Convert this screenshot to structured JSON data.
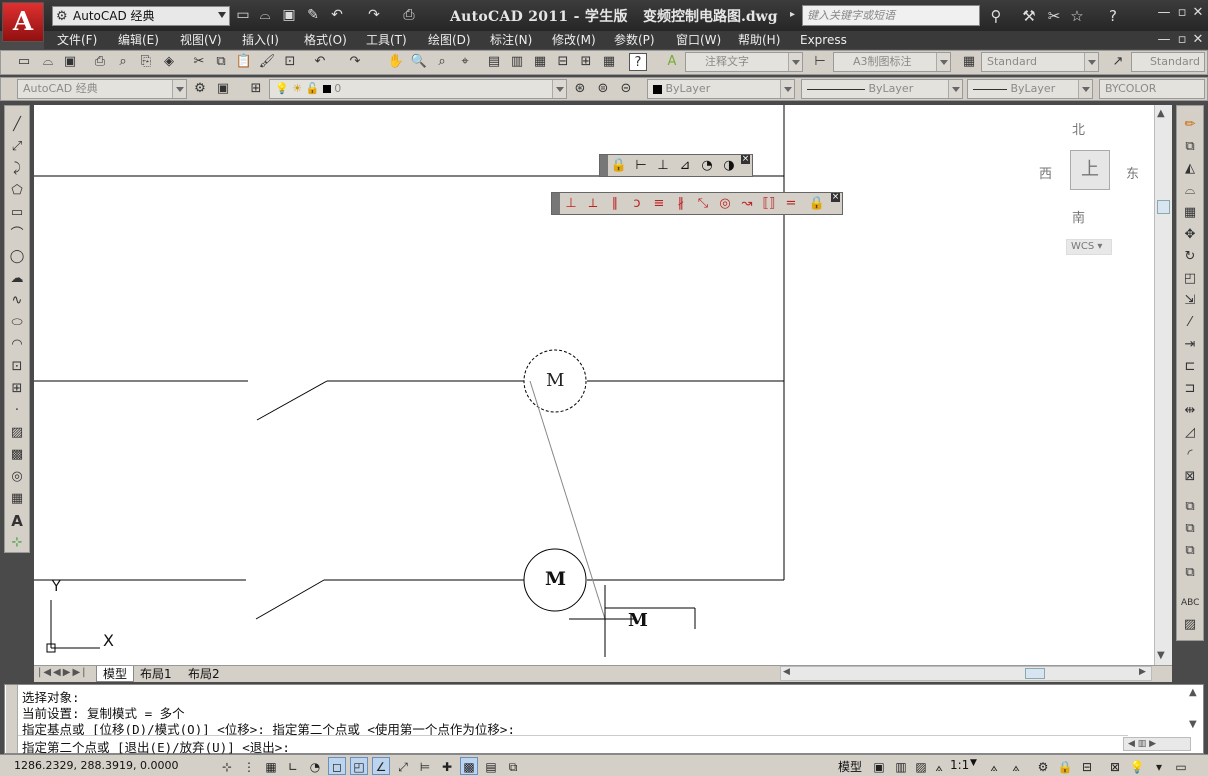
{
  "title": {
    "app": "AutoCAD 2011 - 学生版",
    "file": "变频控制电路图.dwg",
    "workspace": "AutoCAD 经典",
    "search_placeholder": "键入关键字或短语"
  },
  "menus": [
    "文件(F)",
    "编辑(E)",
    "视图(V)",
    "插入(I)",
    "格式(O)",
    "工具(T)",
    "绘图(D)",
    "标注(N)",
    "修改(M)",
    "参数(P)",
    "窗口(W)",
    "帮助(H)",
    "Express"
  ],
  "toolbar": {
    "text_style": "注释文字",
    "dim_style": "A3制图标注",
    "table_style": "Standard",
    "mleader_style": "Standard",
    "workspace_combo": "AutoCAD 经典",
    "layer": "0",
    "color": "ByLayer",
    "linetype": "ByLayer",
    "lineweight": "ByLayer",
    "plotstyle": "BYCOLOR"
  },
  "viewcube": {
    "north": "北",
    "south": "南",
    "east": "东",
    "west": "西",
    "face": "上",
    "wcs": "WCS"
  },
  "drawing": {
    "motor_label": "M",
    "ucs_x": "X",
    "ucs_y": "Y"
  },
  "tabs": [
    "模型",
    "布局1",
    "布局2"
  ],
  "command": {
    "lines": [
      "选择对象:",
      "当前设置:  复制模式 = 多个",
      "指定基点或 [位移(D)/模式(O)] <位移>: 指定第二个点或 <使用第一个点作为位移>:",
      "指定第二个点或 [退出(E)/放弃(U)] <退出>:"
    ]
  },
  "status": {
    "coords": "1286.2329, 288.3919, 0.0000",
    "model": "模型",
    "scale": "1:1"
  },
  "colors": {
    "titlebar": "#2e2e2e",
    "canvas": "#ffffff",
    "accent": "#c01818"
  }
}
